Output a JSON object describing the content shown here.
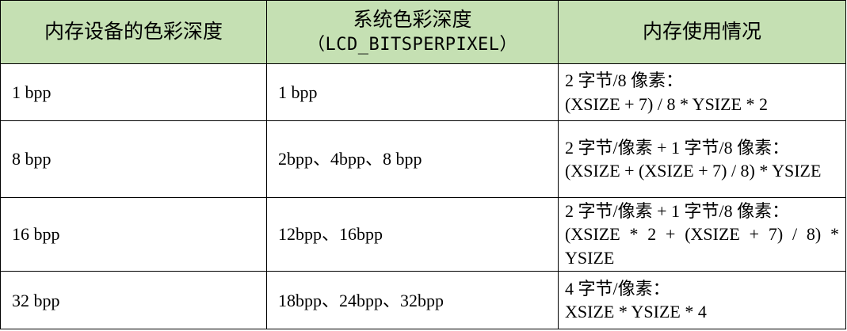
{
  "table": {
    "headers": [
      {
        "label": "内存设备的色彩深度",
        "sub": ""
      },
      {
        "label": "系统色彩深度",
        "sub": "（LCD_BITSPERPIXEL）"
      },
      {
        "label": "内存使用情况",
        "sub": ""
      }
    ],
    "rows": [
      {
        "device_depth": "1 bpp",
        "system_depth": "1 bpp",
        "usage_lines": [
          "2 字节/8 像素：",
          "(XSIZE + 7) / 8 * YSIZE * 2"
        ]
      },
      {
        "device_depth": "8 bpp",
        "system_depth": "2bpp、4bpp、8 bpp",
        "usage_lines": [
          "2 字节/像素 + 1 字节/8 像素：",
          "(XSIZE + (XSIZE + 7) / 8) * YSIZE"
        ]
      },
      {
        "device_depth": "16 bpp",
        "system_depth": "12bpp、16bpp",
        "usage_lines": [
          "2 字节/像素 + 1 字节/8 像素：",
          "(XSIZE * 2 + (XSIZE + 7) / 8) * YSIZE"
        ]
      },
      {
        "device_depth": "32 bpp",
        "system_depth": "18bpp、24bpp、32bpp",
        "usage_lines": [
          "4 字节/像素：",
          "XSIZE * YSIZE * 4"
        ]
      }
    ]
  },
  "colors": {
    "header_background": "#c5e0b3",
    "border": "#000000"
  }
}
